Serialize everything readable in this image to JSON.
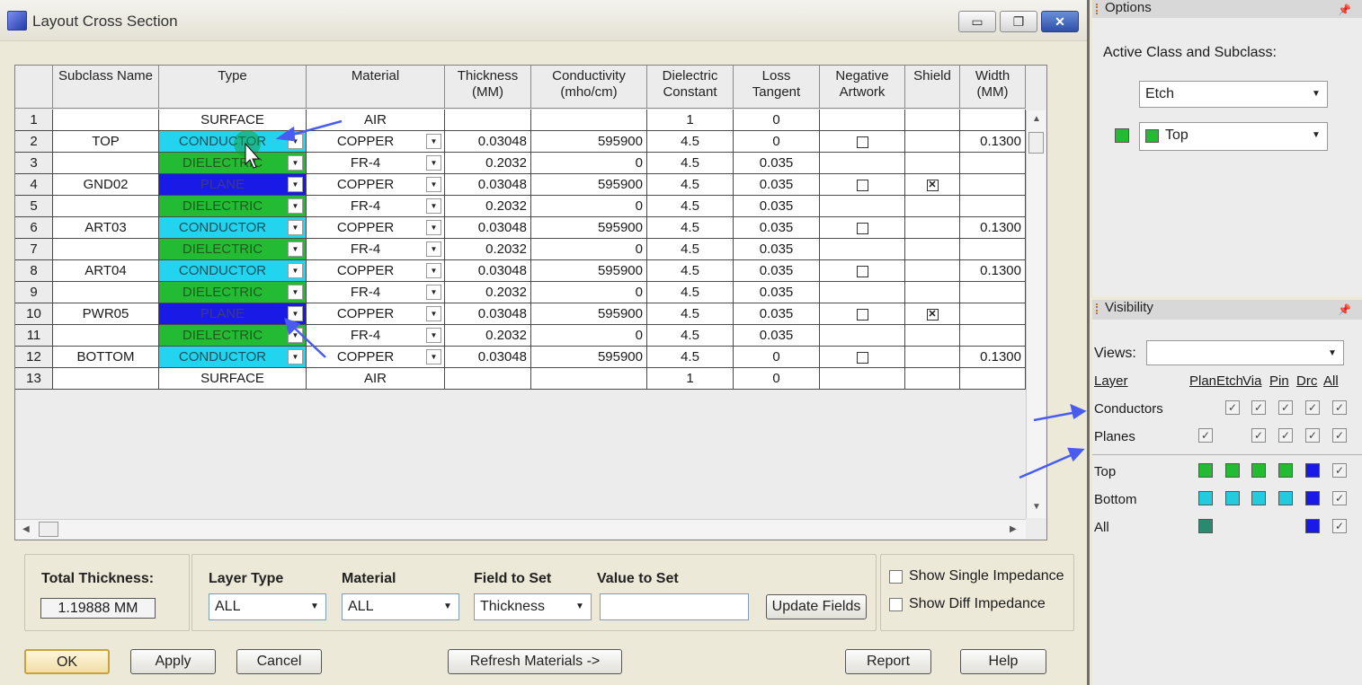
{
  "window": {
    "title": "Layout Cross Section",
    "controls": {
      "minimize": "▭",
      "maximize": "❐",
      "close": "✕"
    }
  },
  "table": {
    "headers": [
      "",
      "Subclass Name",
      "Type",
      "Material",
      "Thickness\n(MM)",
      "Conductivity\n(mho/cm)",
      "Dielectric\nConstant",
      "Loss\nTangent",
      "Negative\nArtwork",
      "Shield",
      "Width\n(MM)"
    ],
    "rows": [
      {
        "n": "1",
        "name": "",
        "type": "SURFACE",
        "material": "AIR",
        "thickness": "",
        "conductivity": "",
        "dielectric": "1",
        "loss": "0",
        "neg": null,
        "shield": null,
        "width": ""
      },
      {
        "n": "2",
        "name": "TOP",
        "type": "CONDUCTOR",
        "material": "COPPER",
        "thickness": "0.03048",
        "conductivity": "595900",
        "dielectric": "4.5",
        "loss": "0",
        "neg": false,
        "shield": null,
        "width": "0.1300"
      },
      {
        "n": "3",
        "name": "",
        "type": "DIELECTRIC",
        "material": "FR-4",
        "thickness": "0.2032",
        "conductivity": "0",
        "dielectric": "4.5",
        "loss": "0.035",
        "neg": null,
        "shield": null,
        "width": ""
      },
      {
        "n": "4",
        "name": "GND02",
        "type": "PLANE",
        "material": "COPPER",
        "thickness": "0.03048",
        "conductivity": "595900",
        "dielectric": "4.5",
        "loss": "0.035",
        "neg": false,
        "shield": true,
        "width": ""
      },
      {
        "n": "5",
        "name": "",
        "type": "DIELECTRIC",
        "material": "FR-4",
        "thickness": "0.2032",
        "conductivity": "0",
        "dielectric": "4.5",
        "loss": "0.035",
        "neg": null,
        "shield": null,
        "width": ""
      },
      {
        "n": "6",
        "name": "ART03",
        "type": "CONDUCTOR",
        "material": "COPPER",
        "thickness": "0.03048",
        "conductivity": "595900",
        "dielectric": "4.5",
        "loss": "0.035",
        "neg": false,
        "shield": null,
        "width": "0.1300"
      },
      {
        "n": "7",
        "name": "",
        "type": "DIELECTRIC",
        "material": "FR-4",
        "thickness": "0.2032",
        "conductivity": "0",
        "dielectric": "4.5",
        "loss": "0.035",
        "neg": null,
        "shield": null,
        "width": ""
      },
      {
        "n": "8",
        "name": "ART04",
        "type": "CONDUCTOR",
        "material": "COPPER",
        "thickness": "0.03048",
        "conductivity": "595900",
        "dielectric": "4.5",
        "loss": "0.035",
        "neg": false,
        "shield": null,
        "width": "0.1300"
      },
      {
        "n": "9",
        "name": "",
        "type": "DIELECTRIC",
        "material": "FR-4",
        "thickness": "0.2032",
        "conductivity": "0",
        "dielectric": "4.5",
        "loss": "0.035",
        "neg": null,
        "shield": null,
        "width": ""
      },
      {
        "n": "10",
        "name": "PWR05",
        "type": "PLANE",
        "material": "COPPER",
        "thickness": "0.03048",
        "conductivity": "595900",
        "dielectric": "4.5",
        "loss": "0.035",
        "neg": false,
        "shield": true,
        "width": ""
      },
      {
        "n": "11",
        "name": "",
        "type": "DIELECTRIC",
        "material": "FR-4",
        "thickness": "0.2032",
        "conductivity": "0",
        "dielectric": "4.5",
        "loss": "0.035",
        "neg": null,
        "shield": null,
        "width": ""
      },
      {
        "n": "12",
        "name": "BOTTOM",
        "type": "CONDUCTOR",
        "material": "COPPER",
        "thickness": "0.03048",
        "conductivity": "595900",
        "dielectric": "4.5",
        "loss": "0",
        "neg": false,
        "shield": null,
        "width": "0.1300"
      },
      {
        "n": "13",
        "name": "",
        "type": "SURFACE",
        "material": "AIR",
        "thickness": "",
        "conductivity": "",
        "dielectric": "1",
        "loss": "0",
        "neg": null,
        "shield": null,
        "width": ""
      }
    ]
  },
  "type_colors": {
    "CONDUCTOR": "#22d4ee",
    "DIELECTRIC": "#22bb33",
    "PLANE": "#1a1ae6",
    "SURFACE": "#ffffff"
  },
  "bottom": {
    "total_thickness_label": "Total Thickness:",
    "total_thickness_value": "1.19888 MM",
    "layer_type_label": "Layer Type",
    "layer_type_value": "ALL",
    "material_label": "Material",
    "material_value": "ALL",
    "field_to_set_label": "Field to Set",
    "field_to_set_value": "Thickness",
    "value_to_set_label": "Value to Set",
    "value_to_set_value": "",
    "update_fields": "Update Fields",
    "show_single_impedance": "Show Single Impedance",
    "show_diff_impedance": "Show Diff Impedance"
  },
  "buttons": {
    "ok": "OK",
    "apply": "Apply",
    "cancel": "Cancel",
    "refresh": "Refresh Materials ->",
    "report": "Report",
    "help": "Help"
  },
  "options": {
    "title": "Options",
    "active_label": "Active Class and Subclass:",
    "class_value": "Etch",
    "subclass_value": "Top",
    "subclass_color": "#22bb33"
  },
  "visibility": {
    "title": "Visibility",
    "views_label": "Views:",
    "views_value": "",
    "layer_header": "Layer",
    "columns": [
      "Plan",
      "Etch",
      "Via",
      "Pin",
      "Drc",
      "All"
    ],
    "rows": [
      {
        "name": "Conductors",
        "cells": [
          null,
          "check",
          "check",
          "check",
          "check",
          "check"
        ]
      },
      {
        "name": "Planes",
        "cells": [
          "check",
          null,
          "check",
          "check",
          "check",
          "check"
        ]
      },
      {
        "name": "Top",
        "cells": [
          "#22bb33",
          "#22bb33",
          "#22bb33",
          "#22bb33",
          "#1a1ae6",
          "check"
        ]
      },
      {
        "name": "Bottom",
        "cells": [
          "#22ccdd",
          "#22ccdd",
          "#22ccdd",
          "#22ccdd",
          "#1a1ae6",
          "check"
        ]
      },
      {
        "name": "All",
        "cells": [
          "#2a8a70",
          null,
          null,
          null,
          "#1a1ae6",
          "check"
        ]
      }
    ]
  },
  "accent": "#4a5cf0"
}
